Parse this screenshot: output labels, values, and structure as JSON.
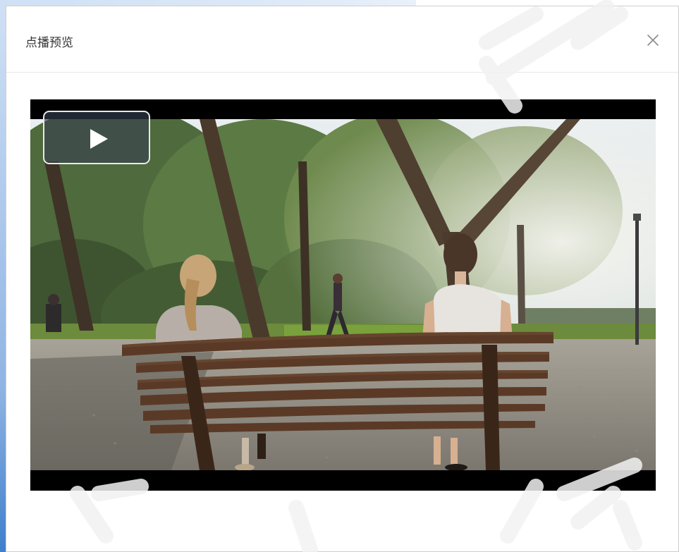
{
  "dialog": {
    "title": "点播预览",
    "close_icon": "close-icon"
  },
  "video": {
    "play_icon": "play-icon",
    "scene": "two-women-on-park-bench"
  },
  "colors": {
    "title_text": "#333333",
    "header_divider": "#e6e6e6",
    "letterbox": "#000000",
    "watermark": "#f3f3f3"
  }
}
